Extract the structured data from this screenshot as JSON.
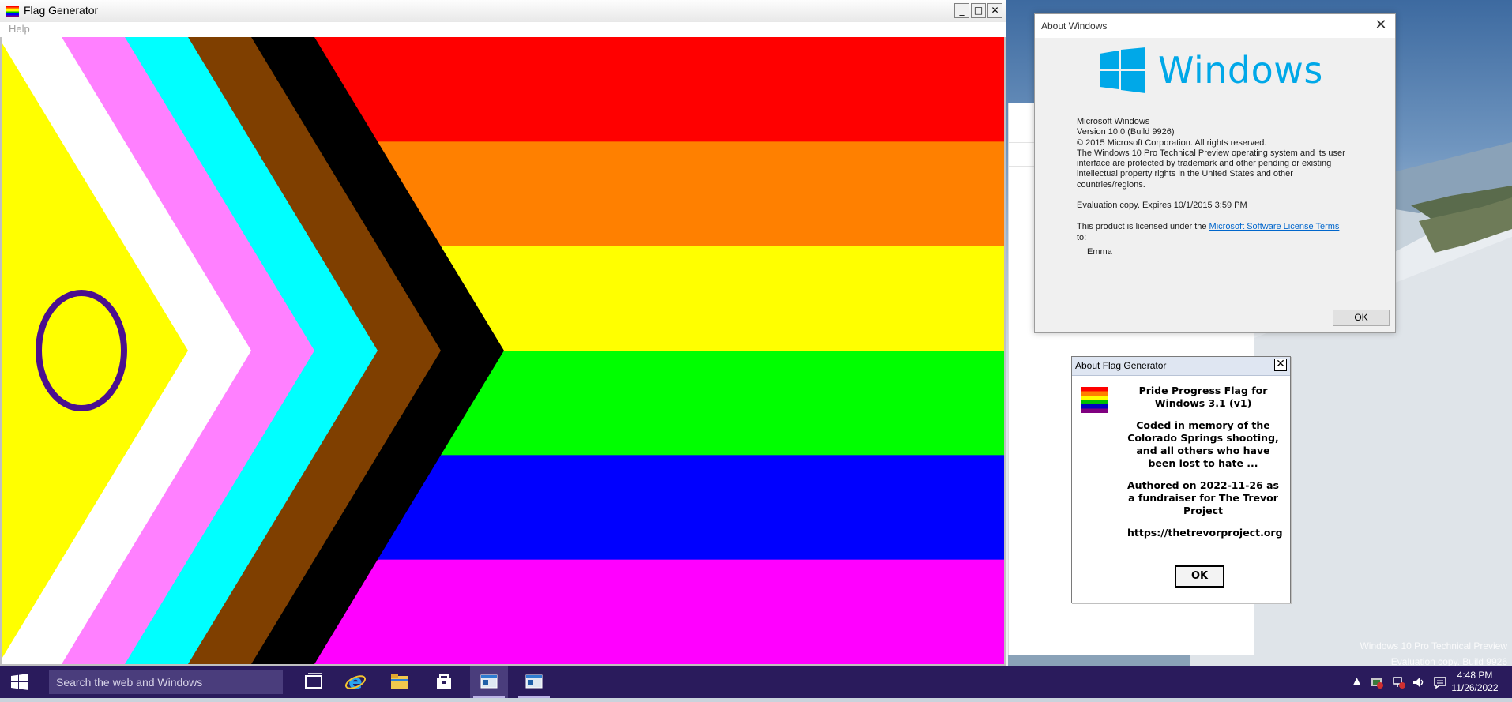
{
  "flag_window": {
    "title": "Flag Generator",
    "menu": [
      "Help"
    ],
    "controls": {
      "minimize": "_",
      "maximize": "□",
      "close": "✕"
    }
  },
  "flag": {
    "stripes": [
      "#ff0000",
      "#ff8000",
      "#ffff00",
      "#00ff00",
      "#0000ff",
      "#ff00ff"
    ],
    "chevrons": [
      "#000000",
      "#7f3f00",
      "#00ffff",
      "#ff80ff",
      "#ffffff",
      "#ffff00"
    ],
    "intersex_ring_color": "#4b0f8f"
  },
  "about_windows": {
    "title": "About Windows",
    "wordmark": "Windows",
    "product": "Microsoft Windows",
    "version": "Version 10.0 (Build 9926)",
    "copyright": "© 2015 Microsoft Corporation. All rights reserved.",
    "legal": "The Windows 10 Pro Technical Preview operating system and its user interface are protected by trademark and other pending or existing intellectual property rights in the United States and other countries/regions.",
    "evaluation": "Evaluation copy. Expires 10/1/2015 3:59 PM",
    "license_prefix": "This product is licensed under the ",
    "license_link": "Microsoft Software License Terms",
    "license_suffix": " to:",
    "licensee": "Emma",
    "ok": "OK",
    "close": "✕"
  },
  "about_flag": {
    "title": "About Flag Generator",
    "close": "✕",
    "heading": "Pride Progress Flag for Windows 3.1 (v1)",
    "memorial": "Coded in memory of the Colorado Springs shooting, and all others who have been lost to hate ...",
    "authored": "Authored on 2022-11-26 as a fundraiser for The Trevor Project",
    "url": "https://thetrevorproject.org",
    "ok": "OK"
  },
  "desktop": {
    "watermark_line1": "Windows 10 Pro Technical Preview",
    "watermark_line2": "Evaluation copy. Build 9926"
  },
  "taskbar": {
    "search_placeholder": "Search the web and Windows",
    "apps": [
      "task-view",
      "internet-explorer",
      "file-explorer",
      "store",
      "flag-generator",
      "about-windows"
    ],
    "tray_chevron": "▲",
    "time": "4:48 PM",
    "date": "11/26/2022"
  }
}
